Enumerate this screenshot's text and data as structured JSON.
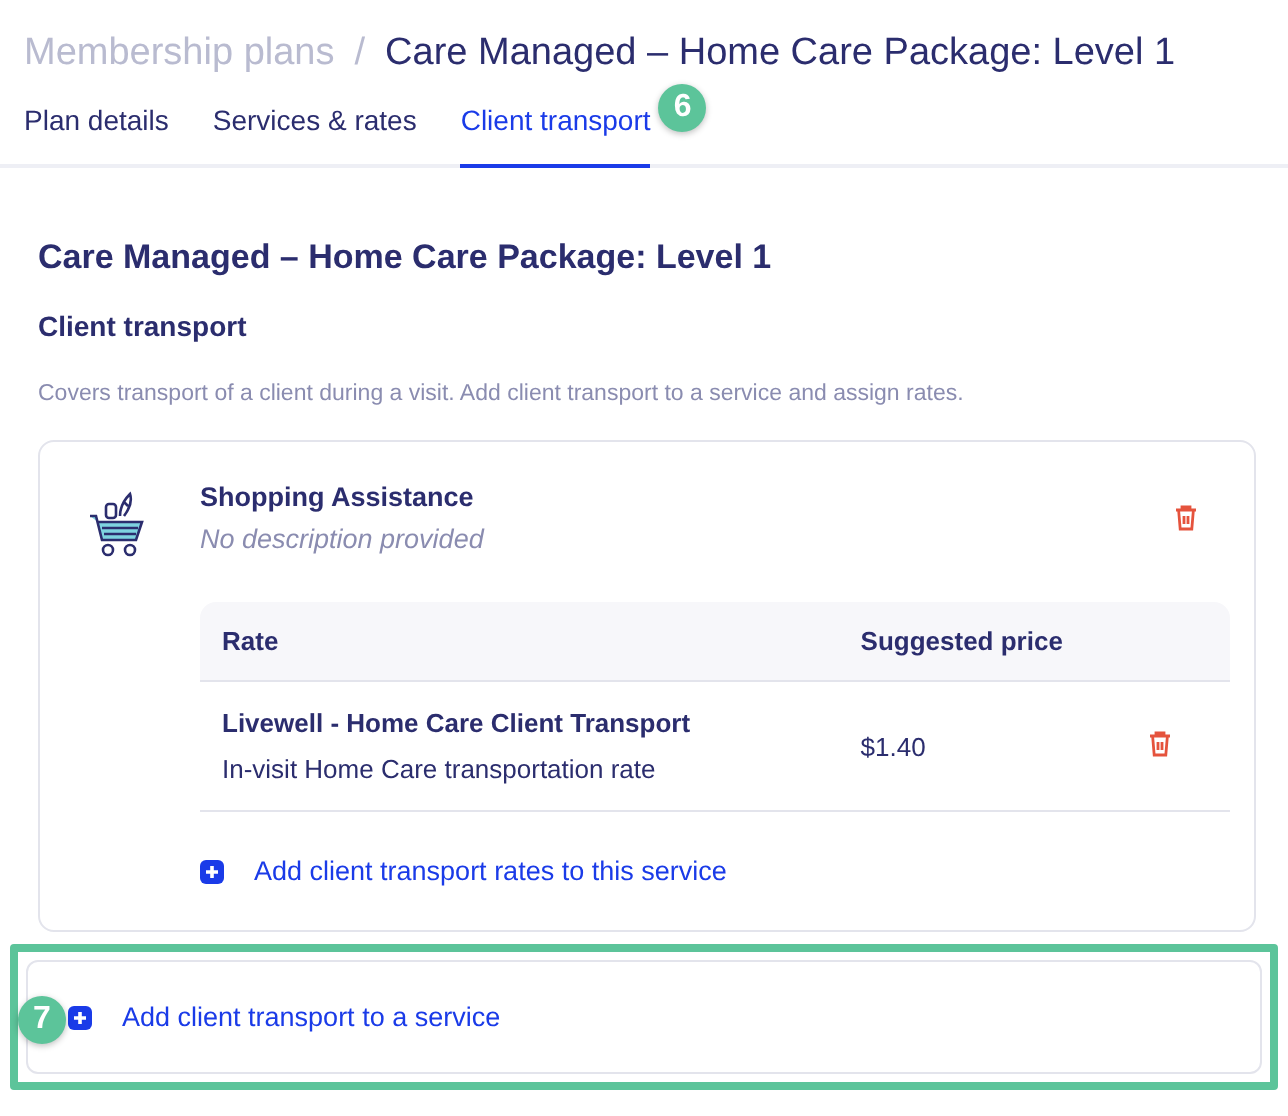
{
  "breadcrumb": {
    "parent": "Membership plans",
    "separator": "/",
    "current": "Care Managed – Home Care Package: Level 1"
  },
  "tabs": [
    {
      "label": "Plan details",
      "selected": false
    },
    {
      "label": "Services & rates",
      "selected": false
    },
    {
      "label": "Client transport",
      "selected": true,
      "badge": "6"
    }
  ],
  "page_title": "Care Managed – Home Care Package: Level 1",
  "section": {
    "title": "Client transport",
    "description": "Covers transport of a client during a visit. Add client transport to a service and assign rates."
  },
  "services": [
    {
      "name": "Shopping Assistance",
      "description": "No description provided",
      "table": {
        "columns": [
          "Rate",
          "Suggested price"
        ],
        "rows": [
          {
            "name": "Livewell - Home Care Client Transport",
            "detail": "In-visit Home Care transportation rate",
            "price": "$1.40"
          }
        ]
      },
      "add_rate": "Add client transport rates to this service"
    }
  ],
  "add_service": {
    "label": "Add client transport to a service",
    "badge": "7",
    "highlighted": true
  }
}
